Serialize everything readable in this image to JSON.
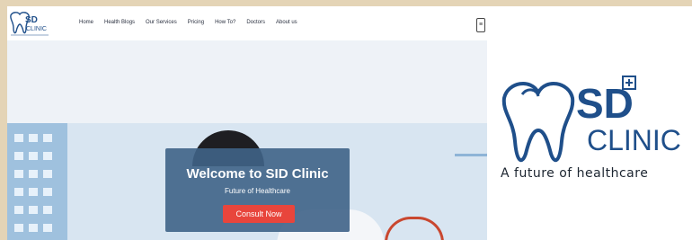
{
  "brand": {
    "name_sd": "SD",
    "name_clinic": "CLINIC",
    "tagline": "A future of healthcare"
  },
  "nav": {
    "links": [
      "Home",
      "Health Blogs",
      "Our Services",
      "Pricing",
      "How To?",
      "Doctors",
      "About us"
    ]
  },
  "hero": {
    "title": "Welcome to SID Clinic",
    "subtitle": "Future of Healthcare",
    "cta": "Consult Now"
  },
  "colors": {
    "primary": "#3f6387",
    "brand_blue": "#1f4f8a",
    "cta": "#e8453c"
  }
}
